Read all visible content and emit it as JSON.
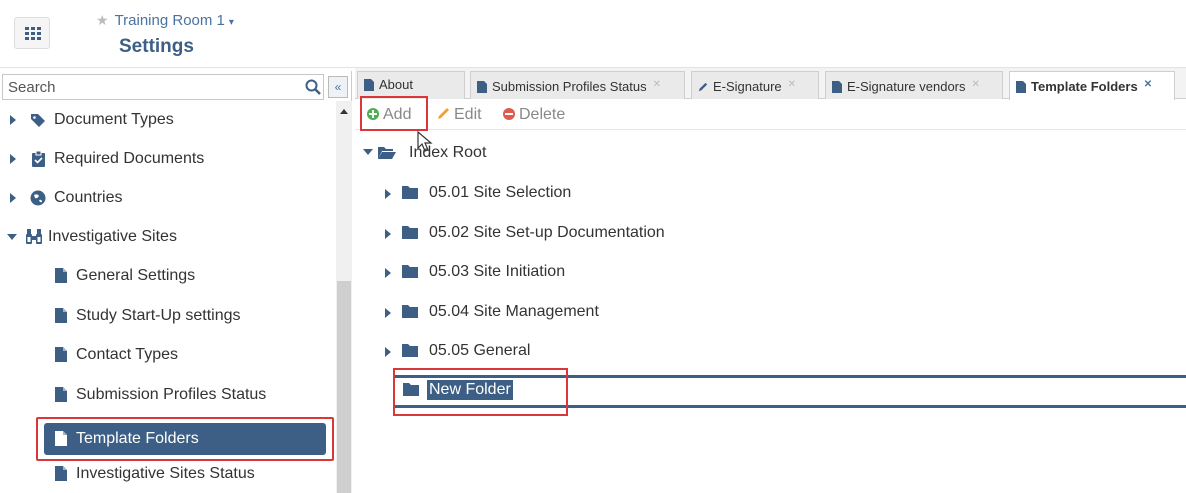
{
  "header": {
    "apps_icon": "grid-icon",
    "room_name": "Training Room 1",
    "room_caret": "▾",
    "page_title": "Settings"
  },
  "sidebar": {
    "search_placeholder": "Search",
    "collapse_glyph": "«",
    "items": [
      {
        "label": "Document Types",
        "icon": "tag-icon",
        "expandable": true,
        "expanded": false
      },
      {
        "label": "Required Documents",
        "icon": "clipboard-icon",
        "expandable": true,
        "expanded": false
      },
      {
        "label": "Countries",
        "icon": "globe-icon",
        "expandable": true,
        "expanded": false
      },
      {
        "label": "Investigative Sites",
        "icon": "binoculars-icon",
        "expandable": true,
        "expanded": true
      },
      {
        "label": "General Settings",
        "icon": "file-icon"
      },
      {
        "label": "Study Start-Up settings",
        "icon": "file-icon"
      },
      {
        "label": "Contact Types",
        "icon": "file-icon"
      },
      {
        "label": "Submission Profiles Status",
        "icon": "file-icon"
      },
      {
        "label": "Template Folders",
        "icon": "file-icon",
        "selected": true
      },
      {
        "label": "Investigative Sites Status",
        "icon": "file-icon"
      }
    ]
  },
  "tabs": [
    {
      "label": "About",
      "closable": false
    },
    {
      "label": "Submission Profiles Status",
      "closable": true
    },
    {
      "label": "E-Signature",
      "closable": true
    },
    {
      "label": "E-Signature vendors",
      "closable": true
    },
    {
      "label": "Template Folders",
      "closable": true,
      "active": true
    }
  ],
  "toolbar": {
    "add_label": "Add",
    "edit_label": "Edit",
    "delete_label": "Delete"
  },
  "folder_tree": {
    "root_label": "Index Root",
    "folders": [
      "05.01 Site Selection",
      "05.02 Site Set-up Documentation",
      "05.03 Site Initiation",
      "05.04 Site Management",
      "05.05 General"
    ],
    "new_folder_label": "New Folder"
  },
  "colors": {
    "accent": "#3d5f86",
    "highlight_outline": "#d9373a",
    "add_green": "#4caf50",
    "delete_red": "#e05a4f",
    "edit_orange": "#f0a030"
  }
}
